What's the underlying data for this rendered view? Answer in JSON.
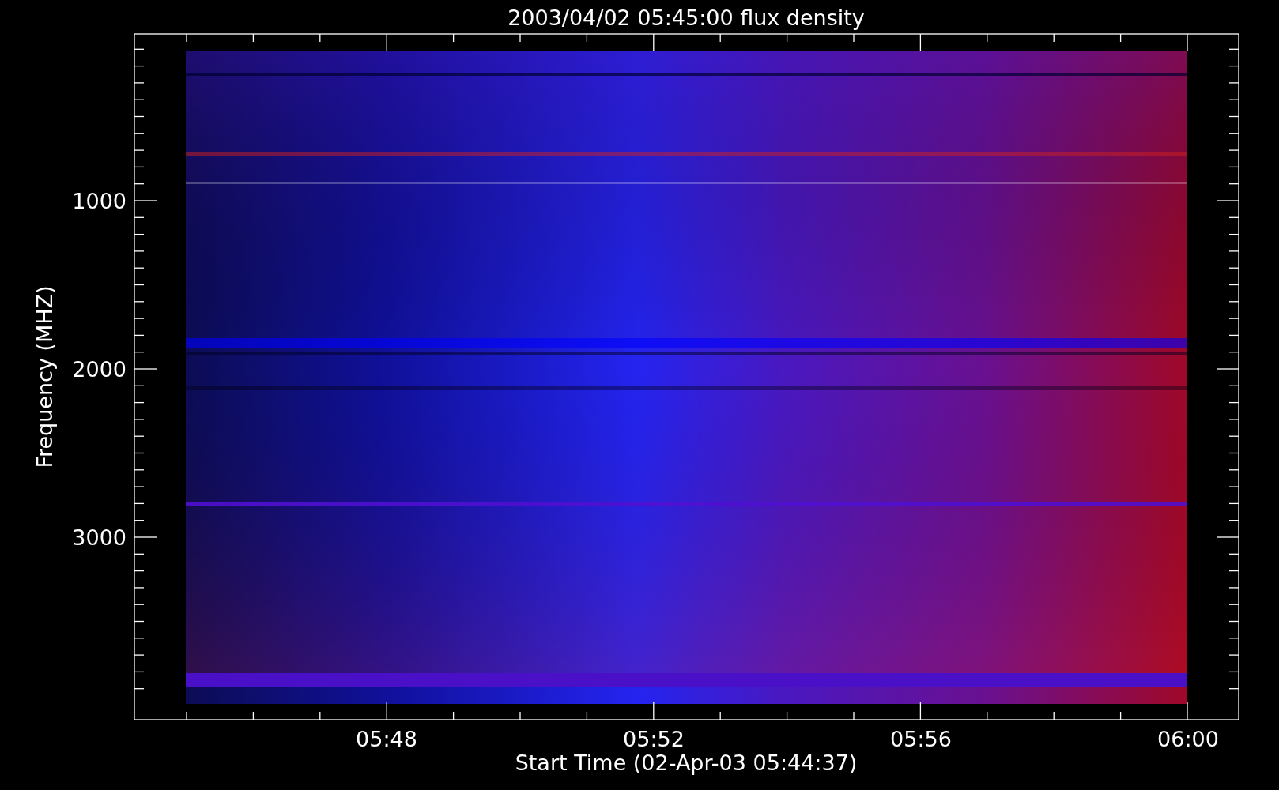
{
  "title": "2003/04/02 05:45:00 flux density",
  "plot": {
    "ylabel": "Frequency (MHZ)",
    "yticks": [
      "1000",
      "2000",
      "3000"
    ],
    "xlabel": "Start Time (02-Apr-03 05:44:37)",
    "xticks": [
      "05:48",
      "05:52",
      "05:56",
      "06:00"
    ]
  }
}
